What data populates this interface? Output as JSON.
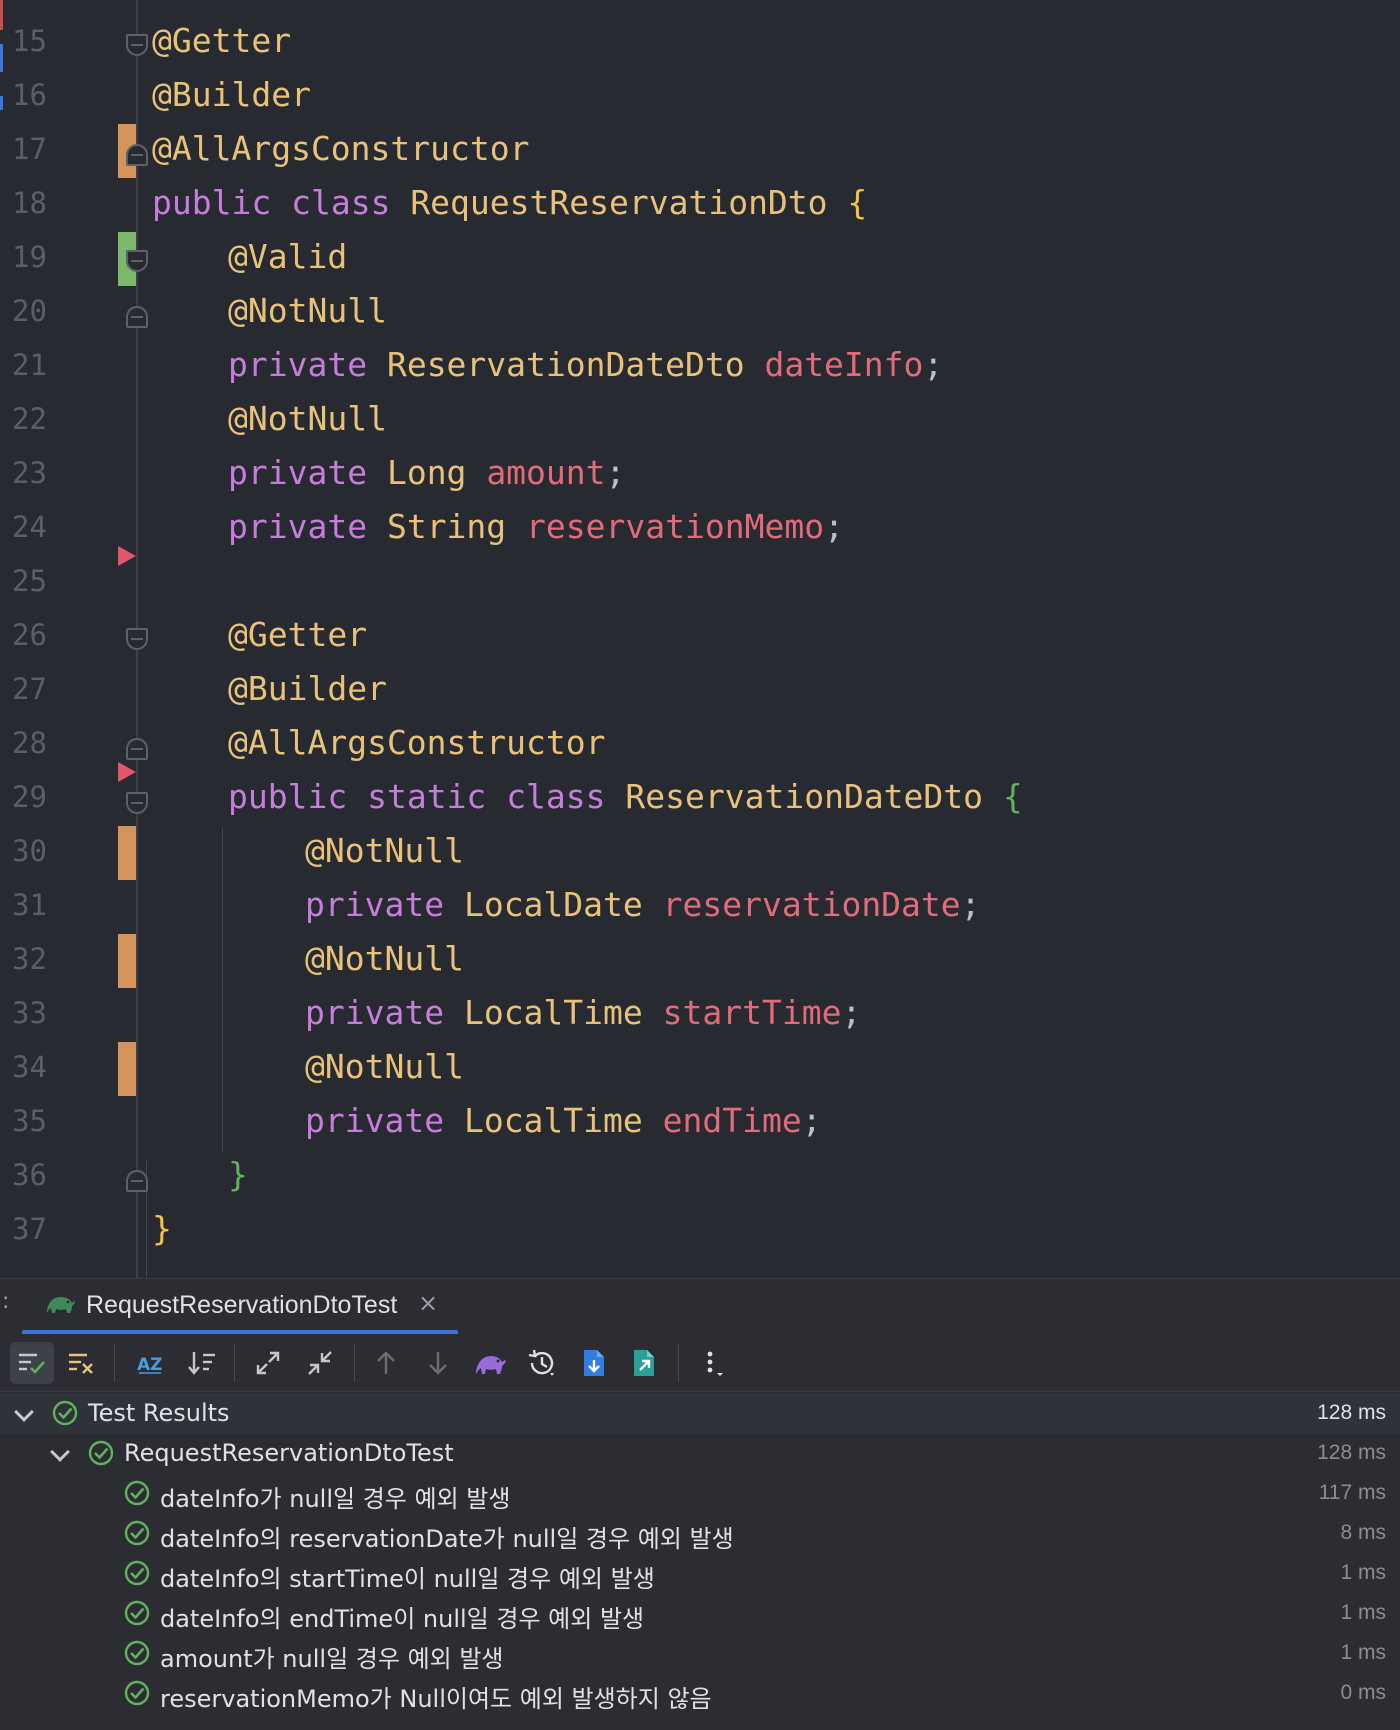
{
  "editor": {
    "lines": [
      {
        "n": "15",
        "indent": 0,
        "tokens": [
          {
            "t": "@Getter",
            "c": "annotation"
          }
        ]
      },
      {
        "n": "16",
        "indent": 0,
        "tokens": [
          {
            "t": "@Builder",
            "c": "annotation"
          }
        ]
      },
      {
        "n": "17",
        "indent": 0,
        "tokens": [
          {
            "t": "@AllArgsConstructor",
            "c": "annotation"
          }
        ]
      },
      {
        "n": "18",
        "indent": 0,
        "tokens": [
          {
            "t": "public",
            "c": "keyword"
          },
          {
            "t": " "
          },
          {
            "t": "class",
            "c": "keyword"
          },
          {
            "t": " "
          },
          {
            "t": "RequestReservationDto",
            "c": "type"
          },
          {
            "t": " "
          },
          {
            "t": "{",
            "c": "brace-y"
          }
        ]
      },
      {
        "n": "19",
        "indent": 1,
        "tokens": [
          {
            "t": "@Valid",
            "c": "annotation"
          }
        ]
      },
      {
        "n": "20",
        "indent": 1,
        "tokens": [
          {
            "t": "@NotNull",
            "c": "annotation"
          }
        ]
      },
      {
        "n": "21",
        "indent": 1,
        "tokens": [
          {
            "t": "private",
            "c": "keyword"
          },
          {
            "t": " "
          },
          {
            "t": "ReservationDateDto",
            "c": "type"
          },
          {
            "t": " "
          },
          {
            "t": "dateInfo",
            "c": "field"
          },
          {
            "t": ";",
            "c": "punct"
          }
        ]
      },
      {
        "n": "22",
        "indent": 1,
        "tokens": [
          {
            "t": "@NotNull",
            "c": "annotation"
          }
        ]
      },
      {
        "n": "23",
        "indent": 1,
        "tokens": [
          {
            "t": "private",
            "c": "keyword"
          },
          {
            "t": " "
          },
          {
            "t": "Long",
            "c": "type"
          },
          {
            "t": " "
          },
          {
            "t": "amount",
            "c": "field"
          },
          {
            "t": ";",
            "c": "punct"
          }
        ]
      },
      {
        "n": "24",
        "indent": 1,
        "tokens": [
          {
            "t": "private",
            "c": "keyword"
          },
          {
            "t": " "
          },
          {
            "t": "String",
            "c": "type"
          },
          {
            "t": " "
          },
          {
            "t": "reservationMemo",
            "c": "field"
          },
          {
            "t": ";",
            "c": "punct"
          }
        ]
      },
      {
        "n": "25",
        "indent": 0,
        "tokens": []
      },
      {
        "n": "26",
        "indent": 1,
        "tokens": [
          {
            "t": "@Getter",
            "c": "annotation"
          }
        ]
      },
      {
        "n": "27",
        "indent": 1,
        "tokens": [
          {
            "t": "@Builder",
            "c": "annotation"
          }
        ]
      },
      {
        "n": "28",
        "indent": 1,
        "tokens": [
          {
            "t": "@AllArgsConstructor",
            "c": "annotation"
          }
        ]
      },
      {
        "n": "29",
        "indent": 1,
        "tokens": [
          {
            "t": "public",
            "c": "keyword"
          },
          {
            "t": " "
          },
          {
            "t": "static",
            "c": "keyword"
          },
          {
            "t": " "
          },
          {
            "t": "class",
            "c": "keyword"
          },
          {
            "t": " "
          },
          {
            "t": "ReservationDateDto",
            "c": "type"
          },
          {
            "t": " "
          },
          {
            "t": "{",
            "c": "brace-g"
          }
        ]
      },
      {
        "n": "30",
        "indent": 2,
        "tokens": [
          {
            "t": "@NotNull",
            "c": "annotation"
          }
        ]
      },
      {
        "n": "31",
        "indent": 2,
        "tokens": [
          {
            "t": "private",
            "c": "keyword"
          },
          {
            "t": " "
          },
          {
            "t": "LocalDate",
            "c": "type"
          },
          {
            "t": " "
          },
          {
            "t": "reservationDate",
            "c": "field"
          },
          {
            "t": ";",
            "c": "punct"
          }
        ]
      },
      {
        "n": "32",
        "indent": 2,
        "tokens": [
          {
            "t": "@NotNull",
            "c": "annotation"
          }
        ]
      },
      {
        "n": "33",
        "indent": 2,
        "tokens": [
          {
            "t": "private",
            "c": "keyword"
          },
          {
            "t": " "
          },
          {
            "t": "LocalTime",
            "c": "type"
          },
          {
            "t": " "
          },
          {
            "t": "startTime",
            "c": "field"
          },
          {
            "t": ";",
            "c": "punct"
          }
        ]
      },
      {
        "n": "34",
        "indent": 2,
        "tokens": [
          {
            "t": "@NotNull",
            "c": "annotation"
          }
        ]
      },
      {
        "n": "35",
        "indent": 2,
        "tokens": [
          {
            "t": "private",
            "c": "keyword"
          },
          {
            "t": " "
          },
          {
            "t": "LocalTime",
            "c": "type"
          },
          {
            "t": " "
          },
          {
            "t": "endTime",
            "c": "field"
          },
          {
            "t": ";",
            "c": "punct"
          }
        ]
      },
      {
        "n": "36",
        "indent": 1,
        "tokens": [
          {
            "t": "}",
            "c": "brace-g"
          }
        ]
      },
      {
        "n": "37",
        "indent": 0,
        "tokens": [
          {
            "t": "}",
            "c": "brace-y"
          }
        ]
      }
    ]
  },
  "run_panel": {
    "tab": {
      "title": "RequestReservationDtoTest",
      "close_glyph": "×",
      "dots": ":"
    },
    "toolbar": {
      "buttons": [
        {
          "name": "show-passed-icon",
          "active": true
        },
        {
          "name": "show-ignored-icon",
          "active": false
        },
        {
          "name": "sort-alphabetically-icon",
          "active": false
        },
        {
          "name": "sort-by-duration-icon",
          "active": false
        },
        {
          "name": "expand-all-icon",
          "active": false
        },
        {
          "name": "collapse-all-icon",
          "active": false
        },
        {
          "name": "previous-test-icon",
          "active": false
        },
        {
          "name": "next-test-icon",
          "active": false
        },
        {
          "name": "gradle-icon",
          "active": false
        },
        {
          "name": "test-history-icon",
          "active": false
        },
        {
          "name": "import-tests-icon",
          "active": false
        },
        {
          "name": "export-tests-icon",
          "active": false
        },
        {
          "name": "more-options-icon",
          "active": false
        }
      ]
    },
    "results": {
      "root": {
        "label": "Test Results",
        "time": "128 ms"
      },
      "suite": {
        "label": "RequestReservationDtoTest",
        "time": "128 ms"
      },
      "tests": [
        {
          "label": "dateInfo가 null일 경우 예외 발생",
          "time": "117 ms"
        },
        {
          "label": "dateInfo의 reservationDate가 null일 경우 예외 발생",
          "time": "8 ms"
        },
        {
          "label": "dateInfo의 startTime이 null일 경우 예외 발생",
          "time": "1 ms"
        },
        {
          "label": "dateInfo의 endTime이 null일 경우 예외 발생",
          "time": "1 ms"
        },
        {
          "label": "amount가 null일 경우 예외 발생",
          "time": "1 ms"
        },
        {
          "label": "reservationMemo가 Null이여도 예외 발생하지 않음",
          "time": "0 ms"
        }
      ]
    }
  },
  "colors": {
    "background": "#282a31",
    "annotation": "#e9c27a",
    "keyword": "#c77ddb",
    "field": "#e26b7a",
    "success": "#5fb35b",
    "tab_underline": "#3d74d8"
  }
}
